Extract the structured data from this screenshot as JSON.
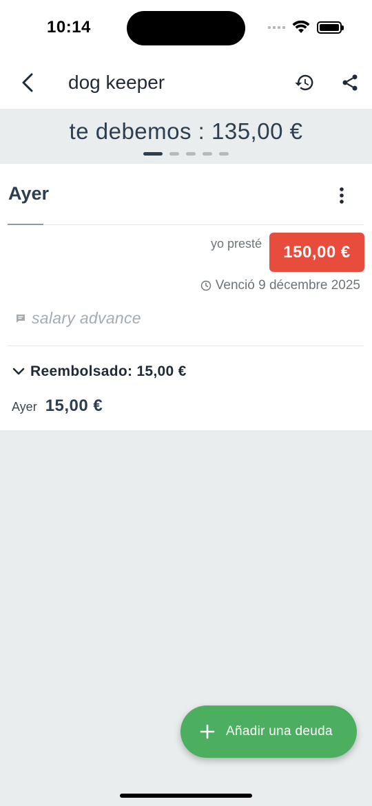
{
  "status_bar": {
    "time": "10:14"
  },
  "app_bar": {
    "title": "dog keeper",
    "back_icon": "chevron-left-icon",
    "history_icon": "history-icon",
    "share_icon": "share-icon"
  },
  "balance": {
    "text": "te debemos : 135,00 €",
    "pages": 5,
    "active_page": 1
  },
  "debt_card": {
    "title": "Ayer",
    "lent_label": "yo presté",
    "amount": "150,00 €",
    "due_text": "Venció 9 décembre 2025",
    "note": "salary advance",
    "repaid_label": "Reembolsado: 15,00 €",
    "payments": [
      {
        "date": "Ayer",
        "amount": "15,00 €"
      }
    ]
  },
  "fab": {
    "label": "Añadir una deuda"
  },
  "colors": {
    "accent_red": "#e74c3c",
    "fab_green": "#4caf5f",
    "text_dark": "#2d3e50",
    "background": "#e9edee"
  }
}
